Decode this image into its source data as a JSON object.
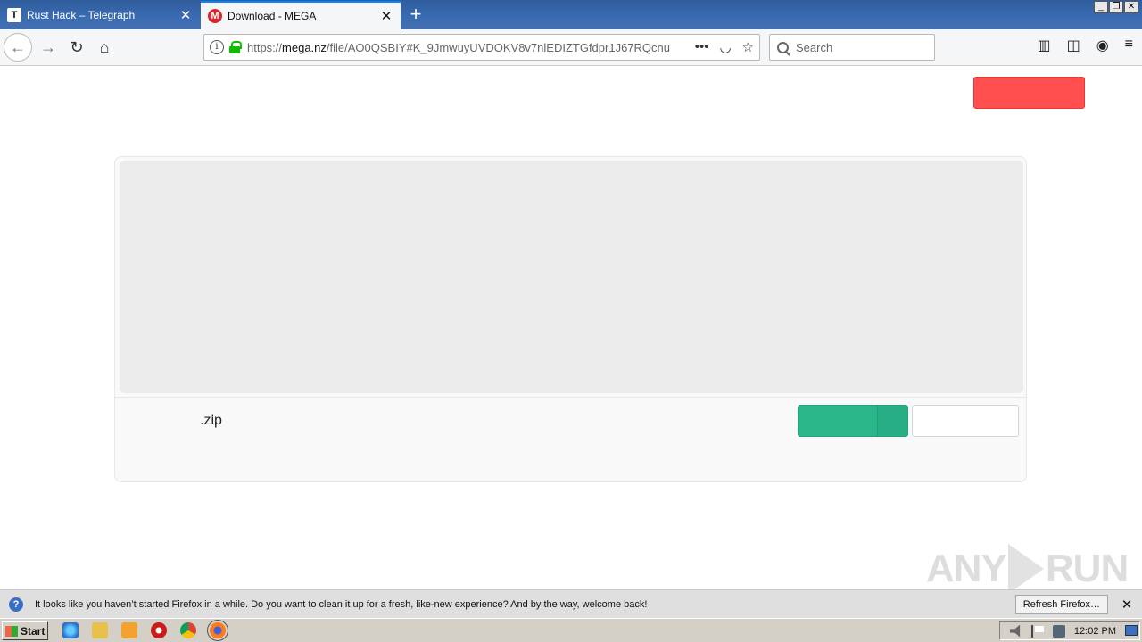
{
  "tabs": [
    {
      "label": "Rust Hack – Telegraph",
      "favicon": "T",
      "active": false
    },
    {
      "label": "Download - MEGA",
      "favicon": "M",
      "active": true
    }
  ],
  "nav": {
    "url_prefix": "https://",
    "url_domain": "mega.nz",
    "url_rest": "/file/AO0QSBIY#K_9JmwuyUVDOKV8v7nlEDIZTGfdpr1J67RQcnu",
    "search_placeholder": "Search"
  },
  "page": {
    "file_name": ".zip"
  },
  "notification": {
    "message": "It looks like you haven’t started Firefox in a while. Do you want to clean it up for a fresh, like-new experience? And by the way, welcome back!",
    "refresh_label": "Refresh Firefox…"
  },
  "taskbar": {
    "start_label": "Start",
    "clock": "12:02 PM"
  },
  "watermark": {
    "left": "ANY",
    "right": "RUN"
  },
  "colors": {
    "accent_blue": "#0a84ff",
    "mega_red": "#d9272e",
    "red_button": "#ff4f4f",
    "green_button": "#2bb68a"
  }
}
